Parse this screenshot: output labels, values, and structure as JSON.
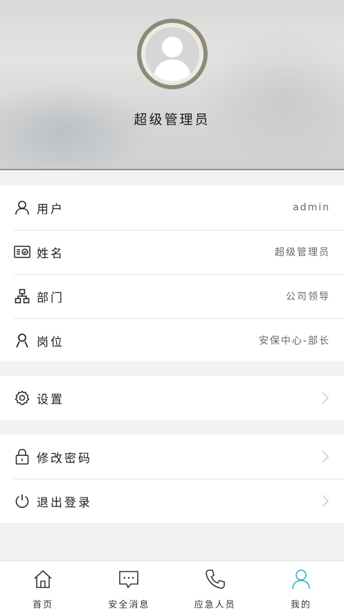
{
  "profile": {
    "display_name": "超级管理员"
  },
  "info_rows": [
    {
      "label": "用户",
      "value": "admin",
      "icon": "user-icon"
    },
    {
      "label": "姓名",
      "value": "超级管理员",
      "icon": "id-card-icon"
    },
    {
      "label": "部门",
      "value": "公司领导",
      "icon": "org-chart-icon"
    },
    {
      "label": "岗位",
      "value": "安保中心-部长",
      "icon": "person-icon"
    }
  ],
  "settings": {
    "label": "设置",
    "icon": "gear-icon"
  },
  "account": {
    "change_password": {
      "label": "修改密码",
      "icon": "lock-icon"
    },
    "logout": {
      "label": "退出登录",
      "icon": "power-icon"
    }
  },
  "tabbar": {
    "items": [
      {
        "label": "首页",
        "icon": "home-icon"
      },
      {
        "label": "安全消息",
        "icon": "message-icon"
      },
      {
        "label": "应急人员",
        "icon": "phone-icon"
      },
      {
        "label": "我的",
        "icon": "profile-icon",
        "active": true
      }
    ],
    "active_color": "#3fb8c9"
  }
}
